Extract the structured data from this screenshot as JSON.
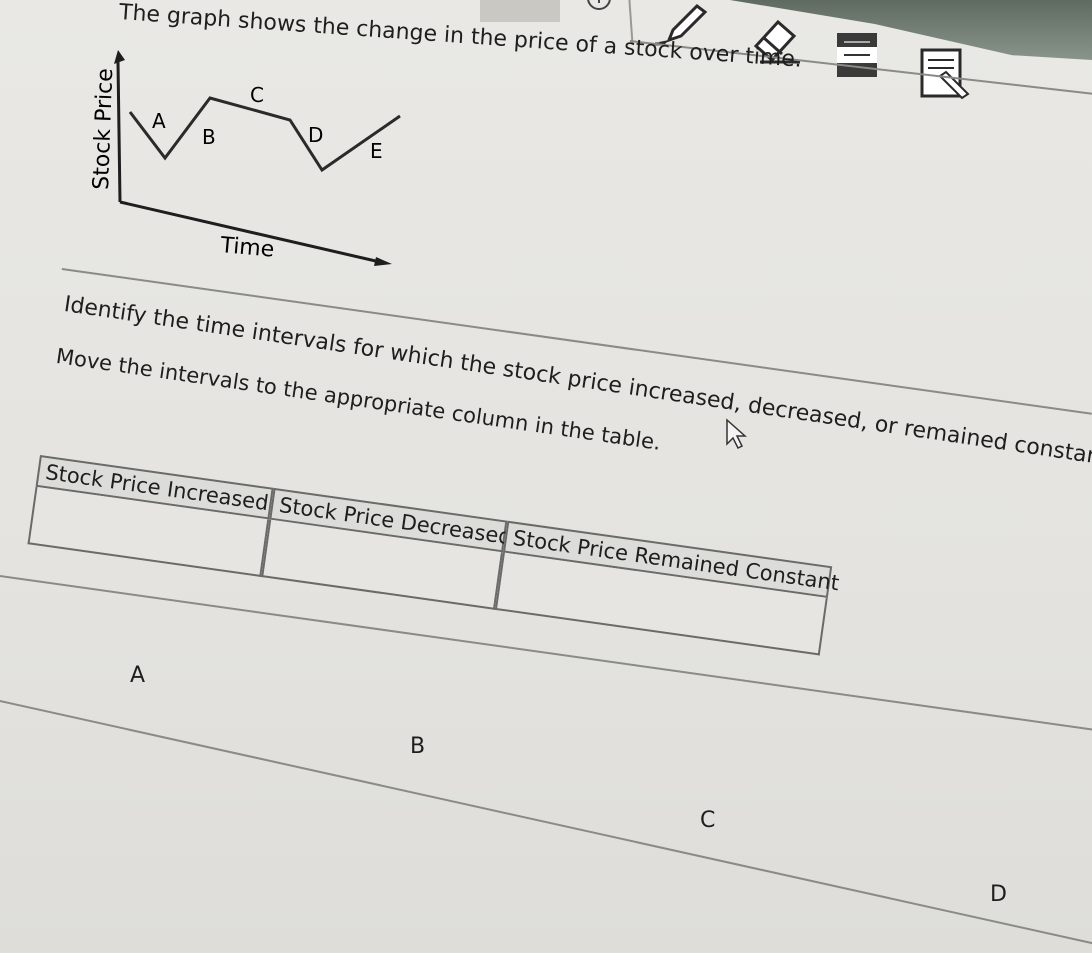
{
  "toolbar": {
    "icons": [
      "zoom-icon",
      "highlighter-icon",
      "eraser-icon",
      "line-reader-icon",
      "notepad-icon"
    ]
  },
  "question": {
    "intro": "The graph shows the change in the price of a stock over time.",
    "instruction_1": "Identify the time intervals for which the stock price increased, decreased, or remained constant.",
    "instruction_2": "Move the intervals to the appropriate column in the table."
  },
  "graph": {
    "y_label": "Stock Price",
    "x_label": "Time",
    "segment_labels": [
      "A",
      "B",
      "C",
      "D",
      "E"
    ]
  },
  "table": {
    "columns": [
      "Stock Price Increased",
      "Stock Price Decreased",
      "Stock Price Remained Constant"
    ]
  },
  "draggable_items": [
    "A",
    "B",
    "C",
    "D"
  ]
}
